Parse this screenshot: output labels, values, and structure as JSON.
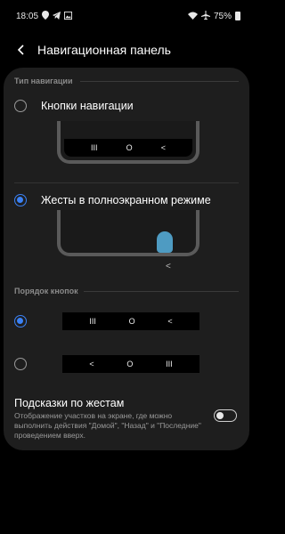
{
  "status_bar": {
    "time": "18:05",
    "left_icons": [
      "location-icon",
      "telegram-icon",
      "gallery-icon"
    ],
    "right_icons": [
      "wifi-icon",
      "airplane-icon",
      "battery-icon"
    ],
    "battery": "75%"
  },
  "header": {
    "title": "Навигационная панель"
  },
  "navigation_type": {
    "section_label": "Тип навигации",
    "options": [
      {
        "label": "Кнопки навигации",
        "selected": false
      },
      {
        "label": "Жесты в полноэкранном режиме",
        "selected": true
      }
    ],
    "preview_buttons_glyphs": [
      "III",
      "O",
      "<"
    ],
    "gesture_chevron": "<"
  },
  "button_order": {
    "section_label": "Порядок кнопок",
    "options": [
      {
        "selected": true,
        "glyphs": [
          "III",
          "O",
          "<"
        ]
      },
      {
        "selected": false,
        "glyphs": [
          "<",
          "O",
          "III"
        ]
      }
    ]
  },
  "gesture_hints": {
    "title": "Подсказки по жестам",
    "description": "Отображение участков на экране, где можно выполнить действия \"Домой\", \"Назад\" и \"Последние\" проведением вверх.",
    "enabled": false
  },
  "colors": {
    "accent": "#3b82f6",
    "card_bg": "#1e1e1e",
    "gesture_blob": "#4e9bc2"
  }
}
